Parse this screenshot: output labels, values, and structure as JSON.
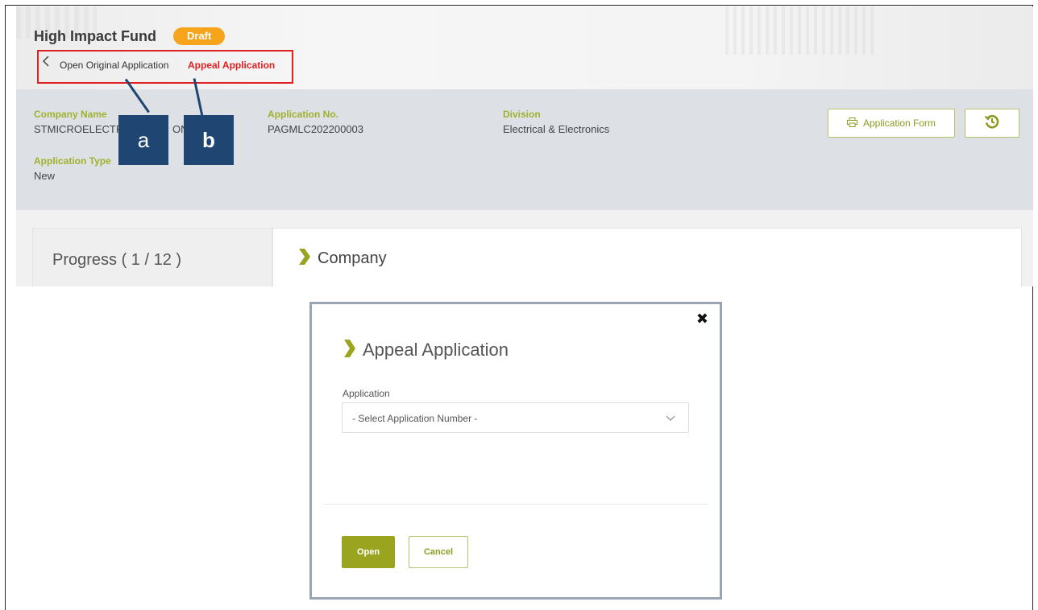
{
  "header": {
    "title": "High Impact Fund",
    "status_badge": "Draft",
    "breadcrumb": {
      "back_label": "Open Original Application",
      "current_label": "Appeal Application"
    }
  },
  "info": {
    "company_name_label": "Company Name",
    "company_name_value": "STMICROELECTR",
    "company_name_value_tail": "ON",
    "application_no_label": "Application No.",
    "application_no_value": "PAGMLC202200003",
    "division_label": "Division",
    "division_value": "Electrical & Electronics",
    "application_type_label": "Application Type",
    "application_type_value": "New",
    "application_form_button": "Application Form"
  },
  "content": {
    "progress_label": "Progress ( 1 / 12 )",
    "section_title": "Company"
  },
  "callouts": {
    "a": "a",
    "b": "b"
  },
  "dialog": {
    "title": "Appeal Application",
    "field_label": "Application",
    "select_placeholder": "- Select Application Number -",
    "open_button": "Open",
    "cancel_button": "Cancel"
  },
  "colors": {
    "accent_green": "#9aa41f",
    "badge_orange": "#f7a41d",
    "highlight_red": "#e02020",
    "callout_navy": "#1f4672"
  }
}
